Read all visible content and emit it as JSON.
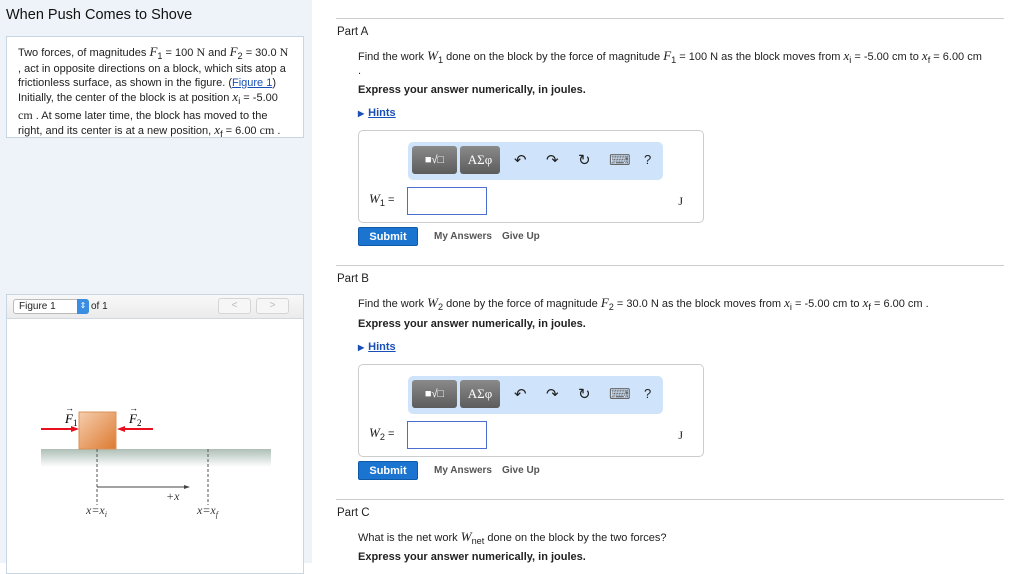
{
  "title": "When Push Comes to Shove",
  "intro": {
    "t1": "Two forces, of magnitudes ",
    "F1": "F",
    "F1sub": "1",
    "eq1": " = 100 ",
    "N": "N",
    "and": " and ",
    "F2": "F",
    "F2sub": "2",
    "eq2": " = 30.0 ",
    "t2": ", act in opposite directions on a block, which sits atop a frictionless surface, as shown in the figure. (",
    "figlink": "Figure 1",
    "t3": ") Initially, the center of the block is at position ",
    "xi": "x",
    "isub": "i",
    "eq3": " = -5.00 ",
    "cm": "cm",
    "t4": " . At some later time, the block has moved to the right, and its center is at a new position, ",
    "xf": "x",
    "fsub": "f",
    "eq4": " = 6.00 ",
    "t5": " ."
  },
  "figure": {
    "select": "Figure 1",
    "of": "of 1",
    "prev": "<",
    "next": ">",
    "f1": "F",
    "f1sub": "1",
    "f2": "F",
    "f2sub": "2",
    "plusx": "+x",
    "xi_label": "x=x",
    "xi_sub": "i",
    "xf_label": "x=x",
    "xf_sub": "f",
    "colors": {
      "block": "#e8955a",
      "arrow": "#e8101e",
      "surface": "#b3c4bc"
    }
  },
  "toolbar": {
    "templates": "■√□",
    "symbols": "ΑΣφ",
    "undo": "↶",
    "redo": "↷",
    "reset": "↻",
    "keyboard": "⌨",
    "help": "?"
  },
  "parts": [
    {
      "label": "Part A",
      "q1": "Find the work ",
      "W": "W",
      "Wsub": "1",
      "q2": " done on the block by the force of magnitude ",
      "F": "F",
      "Fsub": "1",
      "q3": " = 100 N as the block moves from ",
      "q4": " = -5.00 cm to ",
      "q5": " = 6.00 cm",
      "q6": ".",
      "express": "Express your answer numerically, in joules.",
      "hints": "Hints",
      "var": "W",
      "varsub": "1",
      "eq": " =",
      "unit": "J",
      "submit": "Submit",
      "my_answers": "My Answers",
      "give_up": "Give Up"
    },
    {
      "label": "Part B",
      "q1": "Find the work ",
      "W": "W",
      "Wsub": "2",
      "q2": " done by the force of magnitude ",
      "F": "F",
      "Fsub": "2",
      "q3": " = 30.0 N as the block moves from ",
      "q4": " = -5.00 cm to ",
      "q5": " = 6.00 cm .",
      "express": "Express your answer numerically, in joules.",
      "hints": "Hints",
      "var": "W",
      "varsub": "2",
      "eq": " =",
      "unit": "J",
      "submit": "Submit",
      "my_answers": "My Answers",
      "give_up": "Give Up"
    },
    {
      "label": "Part C",
      "q1": "What is the net work ",
      "W": "W",
      "Wsub": "net",
      "q2": " done on the block by the two forces?",
      "express": "Express your answer numerically, in joules."
    }
  ]
}
